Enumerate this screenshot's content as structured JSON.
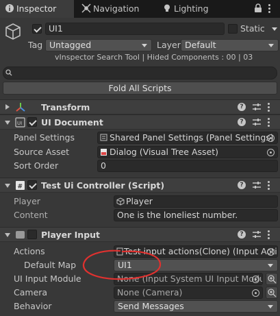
{
  "tabs": [
    {
      "label": "Inspector",
      "icon": "info-icon"
    },
    {
      "label": "Navigation",
      "icon": "navigation-icon"
    },
    {
      "label": "Lighting",
      "icon": "lightbulb-icon"
    }
  ],
  "object": {
    "name": "UI1",
    "active": true,
    "static_label": "Static",
    "static": false,
    "tag_label": "Tag",
    "tag_value": "Untagged",
    "layer_label": "Layer",
    "layer_value": "Default"
  },
  "vinspector_info": "vInspector Search Tool | Hided Components : 00 | 03",
  "search": {
    "placeholder": "",
    "value": ""
  },
  "fold_all_label": "Fold All Scripts",
  "transform": {
    "title": "Transform"
  },
  "ui_document": {
    "title": "UI Document",
    "enabled": true,
    "rows": [
      {
        "label": "Panel Settings",
        "value": "Shared Panel Settings (Panel Settings)"
      },
      {
        "label": "Source Asset",
        "value": "Dialog (Visual Tree Asset)"
      },
      {
        "label": "Sort Order",
        "value": "0"
      }
    ]
  },
  "test_ui_controller": {
    "title": "Test Ui Controller (Script)",
    "enabled": true,
    "rows": [
      {
        "label": "Player",
        "value": "Player"
      },
      {
        "label": "Content",
        "value": "One is the loneliest number."
      }
    ]
  },
  "player_input": {
    "title": "Player Input",
    "enabled": false,
    "rows": [
      {
        "label": "Actions",
        "value": "Test input actions(Clone) (Input Acti"
      },
      {
        "label": "Default Map",
        "value": "UI1"
      },
      {
        "label": "UI Input Module",
        "value": "None (Input System UI Input Modul"
      },
      {
        "label": "Camera",
        "value": "None (Camera)"
      },
      {
        "label": "Behavior",
        "value": "Send Messages"
      }
    ]
  },
  "colors": {
    "annotation": "#e0312f",
    "accent": "#2c5d87"
  }
}
